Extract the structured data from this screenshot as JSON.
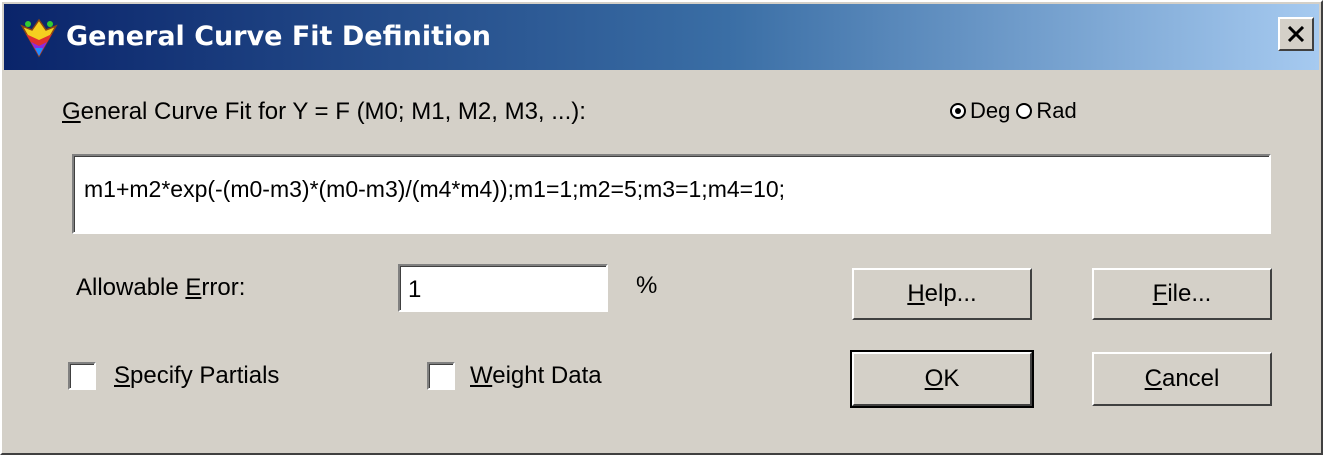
{
  "window": {
    "title": "General Curve Fit Definition",
    "close_glyph": "✕"
  },
  "formula_label": {
    "mnemonic": "G",
    "rest": "eneral Curve Fit for Y = F (M0;  M1, M2, M3, ...):"
  },
  "angle_units": {
    "options": [
      {
        "label": "Deg",
        "checked": true
      },
      {
        "label": "Rad",
        "checked": false
      }
    ]
  },
  "formula_field": {
    "value": "m1+m2*exp(-(m0-m3)*(m0-m3)/(m4*m4));m1=1;m2=5;m3=1;m4=10;"
  },
  "allowable_error": {
    "label_pre": "Allowable ",
    "mnemonic": "E",
    "label_post": "rror:",
    "value": "1",
    "unit": "%"
  },
  "checkboxes": {
    "specify_partials": {
      "mnemonic": "S",
      "rest": "pecify Partials",
      "checked": false
    },
    "weight_data": {
      "mnemonic": "W",
      "rest": "eight Data",
      "checked": false
    }
  },
  "buttons": {
    "help": {
      "mnemonic": "H",
      "rest": "elp..."
    },
    "file": {
      "mnemonic": "F",
      "rest": "ile..."
    },
    "ok": {
      "mnemonic": "O",
      "rest": "K"
    },
    "cancel": {
      "mnemonic": "C",
      "rest": "ancel"
    }
  },
  "colors": {
    "dialog_face": "#d4d0c8",
    "titlebar_start": "#0a246a",
    "titlebar_end": "#a6caf0"
  },
  "icons": {
    "app_icon": "app-logo-icon",
    "close_icon": "close-icon"
  }
}
